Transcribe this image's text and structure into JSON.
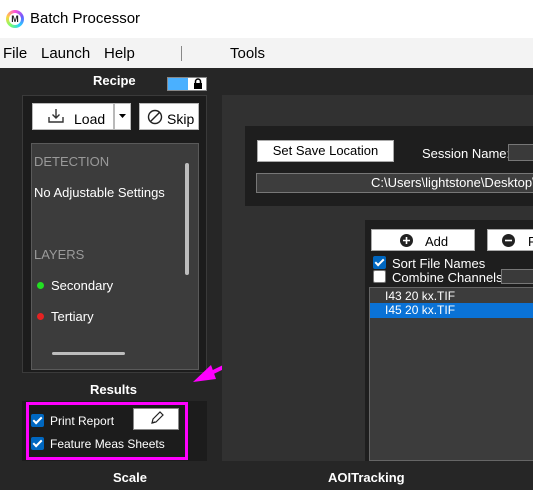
{
  "window": {
    "title": "Batch Processor",
    "logo_letter": "M"
  },
  "menu": {
    "items": [
      "File",
      "Launch",
      "Help",
      "Tools"
    ]
  },
  "recipe": {
    "title": "Recipe",
    "load_label": "Load",
    "skip_label": "Skip",
    "categories": {
      "detection": "DETECTION",
      "detection_item": "No Adjustable Settings",
      "layers": "LAYERS"
    },
    "layers": [
      {
        "label": "Secondary",
        "color": "#22e022"
      },
      {
        "label": "Tertiary",
        "color": "#e52222"
      }
    ]
  },
  "results": {
    "title": "Results",
    "print_report": {
      "label": "Print Report",
      "checked": true
    },
    "feature_meas": {
      "label": "Feature Meas Sheets",
      "checked": true
    }
  },
  "session": {
    "save_location_label": "Set Save Location",
    "session_name_label": "Session Name:",
    "path": "C:\\Users\\lightstone\\Desktop\\D"
  },
  "files": {
    "add_label": "Add",
    "remove_label": "R",
    "sort_label": "Sort File Names",
    "sort_checked": true,
    "combine_label": "Combine Channels",
    "combine_checked": false,
    "items": [
      {
        "name": "I43 20 kx.TIF",
        "selected": false
      },
      {
        "name": "I45 20 kx.TIF",
        "selected": true
      }
    ]
  },
  "bottom": {
    "scale_label": "Scale",
    "aoi_label": "AOITracking"
  },
  "colors": {
    "highlight": "#ff00ff",
    "accent": "#0a72d6",
    "toggle": "#4ab0ff"
  }
}
